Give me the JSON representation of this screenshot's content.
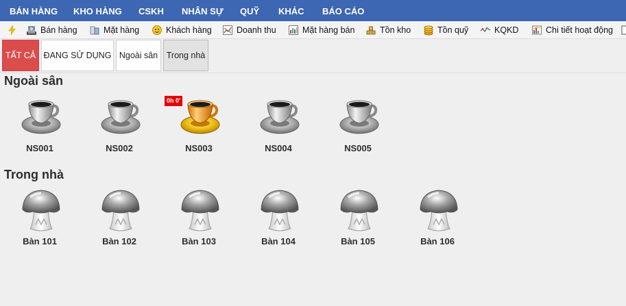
{
  "menu": {
    "items": [
      {
        "label": "BÁN HÀNG"
      },
      {
        "label": "KHO HÀNG"
      },
      {
        "label": "CSKH"
      },
      {
        "label": "NHÂN SỰ"
      },
      {
        "label": "QUỸ"
      },
      {
        "label": "KHÁC"
      },
      {
        "label": "BÁO CÁO"
      }
    ]
  },
  "toolbar": {
    "items": [
      {
        "label": "",
        "icon": "lightning-icon"
      },
      {
        "label": "Bán hàng",
        "icon": "cashier-icon"
      },
      {
        "label": "Mặt hàng",
        "icon": "product-icon"
      },
      {
        "label": "Khách hàng",
        "icon": "customer-icon"
      },
      {
        "label": "Doanh thu",
        "icon": "revenue-icon"
      },
      {
        "label": "Mặt hàng bán",
        "icon": "bar-chart-icon"
      },
      {
        "label": "Tồn kho",
        "icon": "stock-icon"
      },
      {
        "label": "Tồn quỹ",
        "icon": "coins-icon"
      },
      {
        "label": "KQKD",
        "icon": "trend-icon"
      },
      {
        "label": "Chi tiết hoạt động",
        "icon": "activity-icon"
      }
    ]
  },
  "tabs": {
    "all": "TẤT CẢ",
    "in_use": "ĐANG SỬ DỤNG",
    "outdoor": "Ngoài sân",
    "indoor": "Trong nhà"
  },
  "sections": {
    "outdoor": {
      "title": "Ngoài sân",
      "tables": [
        {
          "name": "NS001",
          "active": false,
          "badge": ""
        },
        {
          "name": "NS002",
          "active": false,
          "badge": ""
        },
        {
          "name": "NS003",
          "active": true,
          "badge": "0h 0'"
        },
        {
          "name": "NS004",
          "active": false,
          "badge": ""
        },
        {
          "name": "NS005",
          "active": false,
          "badge": ""
        }
      ]
    },
    "indoor": {
      "title": "Trong nhà",
      "tables": [
        {
          "name": "Bàn 101"
        },
        {
          "name": "Bàn 102"
        },
        {
          "name": "Bàn 103"
        },
        {
          "name": "Bàn 104"
        },
        {
          "name": "Bàn 105"
        },
        {
          "name": "Bàn 106"
        }
      ]
    }
  },
  "colors": {
    "menu_bg": "#3d66b3",
    "tab_active_bg": "#db4c4c",
    "badge_bg": "#e60000",
    "cup_active": "#f09a1e"
  }
}
